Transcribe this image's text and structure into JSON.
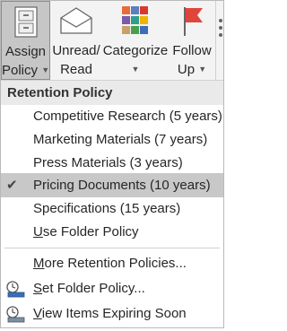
{
  "ribbon": {
    "buttons": [
      {
        "line1": "Assign",
        "line2": "Policy",
        "icon": "assign-policy-icon",
        "pressed": true
      },
      {
        "line1": "Unread/",
        "line2": "Read",
        "icon": "envelope-icon"
      },
      {
        "line1": "Categorize",
        "line2": "",
        "icon": "categorize-icon"
      },
      {
        "line1": "Follow",
        "line2": "Up",
        "icon": "flag-icon"
      }
    ]
  },
  "menu": {
    "header": "Retention Policy",
    "items": [
      {
        "label": "Competitive Research (5 years)"
      },
      {
        "label": "Marketing Materials (7 years)"
      },
      {
        "label": "Press Materials (3 years)"
      },
      {
        "label": "Pricing Documents (10 years)",
        "checked": true
      },
      {
        "label": "Specifications (15 years)"
      },
      {
        "label_pre": "",
        "label_u": "U",
        "label_post": "se Folder Policy"
      }
    ],
    "actions": [
      {
        "label_pre": "",
        "label_u": "M",
        "label_post": "ore Retention Policies...",
        "icon": ""
      },
      {
        "label_pre": "",
        "label_u": "S",
        "label_post": "et Folder Policy...",
        "icon": "set-folder-policy-icon"
      },
      {
        "label_pre": "",
        "label_u": "V",
        "label_post": "iew Items Expiring Soon",
        "icon": "view-expiring-icon"
      }
    ]
  },
  "colors": {
    "ribbon_bg": "#f3f3f3",
    "pressed_bg": "#c6c6c6",
    "header_bg": "#eaeaea",
    "checked_bg": "#c8c8c8",
    "flag_red": "#e0453c"
  }
}
